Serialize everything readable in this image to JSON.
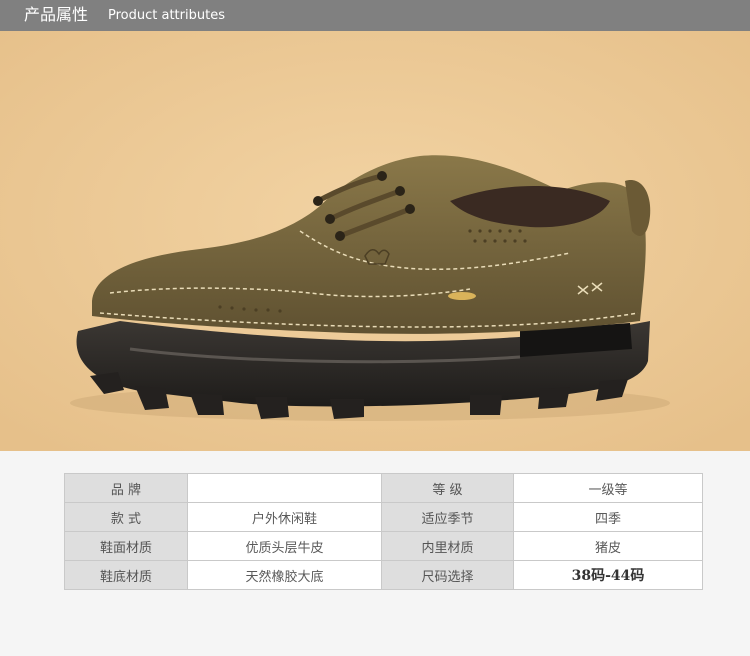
{
  "header": {
    "title_cn": "产品属性",
    "title_en": "Product attributes"
  },
  "colors": {
    "header_bg": "#808080",
    "hero_bg": "#ecc894",
    "shoe_leather": "#7b6a3f",
    "sole": "#2f2c29"
  },
  "hero": {
    "image_icon": "shoe-icon"
  },
  "specs": {
    "rows": [
      {
        "label1": "品    牌",
        "value1": "",
        "label2": "等    级",
        "value2": "一级等"
      },
      {
        "label1": "款    式",
        "value1": "户外休闲鞋",
        "label2": "适应季节",
        "value2": "四季"
      },
      {
        "label1": "鞋面材质",
        "value1": "优质头层牛皮",
        "label2": "内里材质",
        "value2": "猪皮"
      },
      {
        "label1": "鞋底材质",
        "value1": "天然橡胶大底",
        "label2": "尺码选择",
        "value2": "38码-44码"
      }
    ]
  }
}
